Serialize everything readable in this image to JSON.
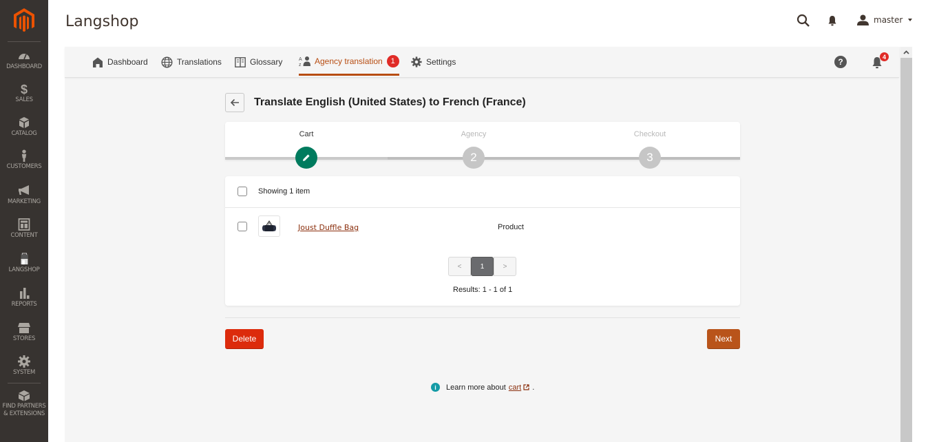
{
  "sidebar": {
    "items": [
      {
        "label": "DASHBOARD",
        "icon": "speedometer-icon"
      },
      {
        "label": "SALES",
        "icon": "dollar-icon"
      },
      {
        "label": "CATALOG",
        "icon": "box-icon"
      },
      {
        "label": "CUSTOMERS",
        "icon": "person-icon"
      },
      {
        "label": "MARKETING",
        "icon": "megaphone-icon"
      },
      {
        "label": "CONTENT",
        "icon": "layout-icon"
      },
      {
        "label": "LANGSHOP",
        "icon": "shopping-bag-icon"
      },
      {
        "label": "REPORTS",
        "icon": "bar-chart-icon"
      },
      {
        "label": "STORES",
        "icon": "storefront-icon"
      },
      {
        "label": "SYSTEM",
        "icon": "gear-icon"
      },
      {
        "label_line1": "FIND PARTNERS",
        "label_line2": "& EXTENSIONS",
        "icon": "lego-block-icon"
      }
    ]
  },
  "header": {
    "title": "Langshop",
    "user": "master"
  },
  "tabs": [
    {
      "label": "Dashboard",
      "icon": "home-icon"
    },
    {
      "label": "Translations",
      "icon": "globe-icon"
    },
    {
      "label": "Glossary",
      "icon": "book-icon"
    },
    {
      "label": "Agency translation",
      "icon": "translate-person-icon",
      "badge": "1",
      "active": true
    },
    {
      "label": "Settings",
      "icon": "gear-icon"
    }
  ],
  "notifications_count": "4",
  "help_label": "?",
  "page": {
    "heading": "Translate English (United States) to French (France)"
  },
  "steps": [
    {
      "label": "Cart",
      "marker": "pencil",
      "state": "current"
    },
    {
      "label": "Agency",
      "marker": "2",
      "state": "pending"
    },
    {
      "label": "Checkout",
      "marker": "3",
      "state": "pending"
    }
  ],
  "list": {
    "summary": "Showing 1 item",
    "items": [
      {
        "name": "Joust Duffle Bag",
        "type": "Product"
      }
    ],
    "pagination": {
      "prev": "<",
      "current": "1",
      "next": ">"
    },
    "results": "Results: 1 - 1 of 1"
  },
  "actions": {
    "delete": "Delete",
    "next": "Next"
  },
  "learn_more": {
    "prefix": "Learn more about",
    "link": "cart",
    "suffix": "."
  },
  "colors": {
    "accent": "#b74d12",
    "step_done": "#007b5e",
    "danger": "#dc2b0c",
    "sidebar_bg": "#373330",
    "logo": "#eb5202"
  }
}
